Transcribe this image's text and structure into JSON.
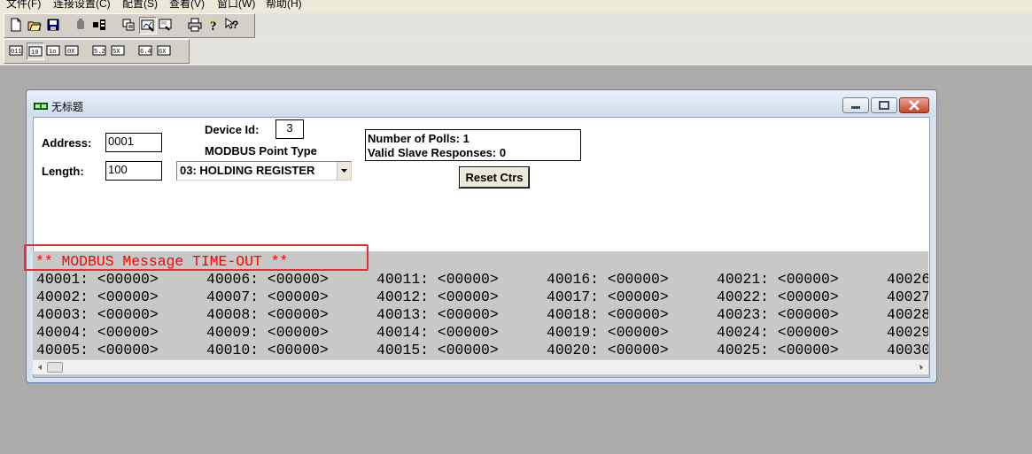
{
  "menu": [
    "文件(F)",
    "连接设置(C)",
    "配置(S)",
    "查看(V)",
    "窗口(W)",
    "帮助(H)"
  ],
  "child_window": {
    "title": "无标题"
  },
  "form": {
    "address_label": "Address:",
    "address_value": "0001",
    "length_label": "Length:",
    "length_value": "100",
    "device_id_label": "Device Id:",
    "device_id_value": "3",
    "point_type_label": "MODBUS Point Type",
    "point_type_value": "03: HOLDING REGISTER"
  },
  "stats": {
    "polls": "Number of Polls: 1",
    "responses": "Valid Slave Responses: 0",
    "reset_label": "Reset Ctrs"
  },
  "status_message": "** MODBUS Message TIME-OUT **",
  "registers": [
    [
      "40001: <00000>",
      "40006: <00000>",
      "40011: <00000>",
      "40016: <00000>",
      "40021: <00000>",
      "40026"
    ],
    [
      "40002: <00000>",
      "40007: <00000>",
      "40012: <00000>",
      "40017: <00000>",
      "40022: <00000>",
      "40027"
    ],
    [
      "40003: <00000>",
      "40008: <00000>",
      "40013: <00000>",
      "40018: <00000>",
      "40023: <00000>",
      "40028"
    ],
    [
      "40004: <00000>",
      "40009: <00000>",
      "40014: <00000>",
      "40019: <00000>",
      "40024: <00000>",
      "40029"
    ],
    [
      "40005: <00000>",
      "40010: <00000>",
      "40015: <00000>",
      "40020: <00000>",
      "40025: <00000>",
      "40030"
    ]
  ],
  "colors": {
    "timeout_red": "#ff0000",
    "highlight": "#e03030"
  },
  "icons": {
    "toolbar1": [
      "new-file-icon",
      "open-folder-icon",
      "save-icon",
      "connect-icon",
      "disconnect-icon",
      "display-format-icon",
      "display-options-icon",
      "view-icon",
      "print-icon",
      "about-icon",
      "help-context-icon"
    ],
    "toolbar2": [
      "func-01-icon",
      "func-02-icon",
      "func-03-icon",
      "func-04-icon",
      "func-05-icon",
      "func-06-icon",
      "func-15-icon",
      "func-16-icon"
    ]
  }
}
